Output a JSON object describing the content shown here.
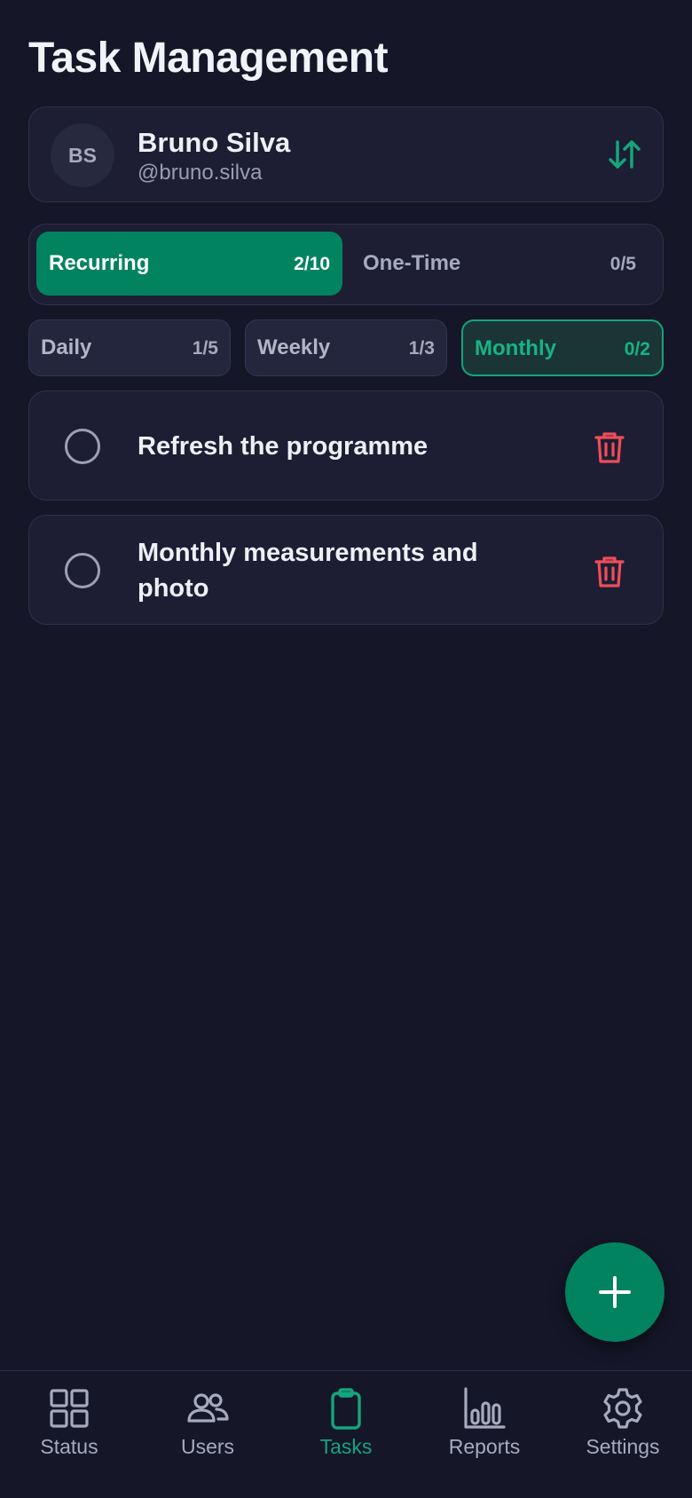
{
  "page": {
    "title": "Task Management"
  },
  "user": {
    "initials": "BS",
    "name": "Bruno Silva",
    "handle": "@bruno.silva",
    "swap_icon": "swap-vertical-icon"
  },
  "type_tabs": [
    {
      "label": "Recurring",
      "count": "2/10",
      "active": true
    },
    {
      "label": "One-Time",
      "count": "0/5",
      "active": false
    }
  ],
  "freq_tabs": [
    {
      "label": "Daily",
      "count": "1/5",
      "active": false
    },
    {
      "label": "Weekly",
      "count": "1/3",
      "active": false
    },
    {
      "label": "Monthly",
      "count": "0/2",
      "active": true
    }
  ],
  "tasks": [
    {
      "title": "Refresh the programme",
      "done": false
    },
    {
      "title": "Monthly measurements and photo",
      "done": false
    }
  ],
  "fab": {
    "icon": "plus-icon"
  },
  "nav": [
    {
      "label": "Status",
      "icon": "grid-icon",
      "active": false
    },
    {
      "label": "Users",
      "icon": "users-icon",
      "active": false
    },
    {
      "label": "Tasks",
      "icon": "clipboard-icon",
      "active": true
    },
    {
      "label": "Reports",
      "icon": "bar-chart-icon",
      "active": false
    },
    {
      "label": "Settings",
      "icon": "gear-icon",
      "active": false
    }
  ],
  "colors": {
    "background": "#151628",
    "card": "#1d1e33",
    "accent": "#02835f",
    "accent_text": "#14a57c",
    "danger": "#ef4d5a",
    "muted": "#a7aabd"
  }
}
